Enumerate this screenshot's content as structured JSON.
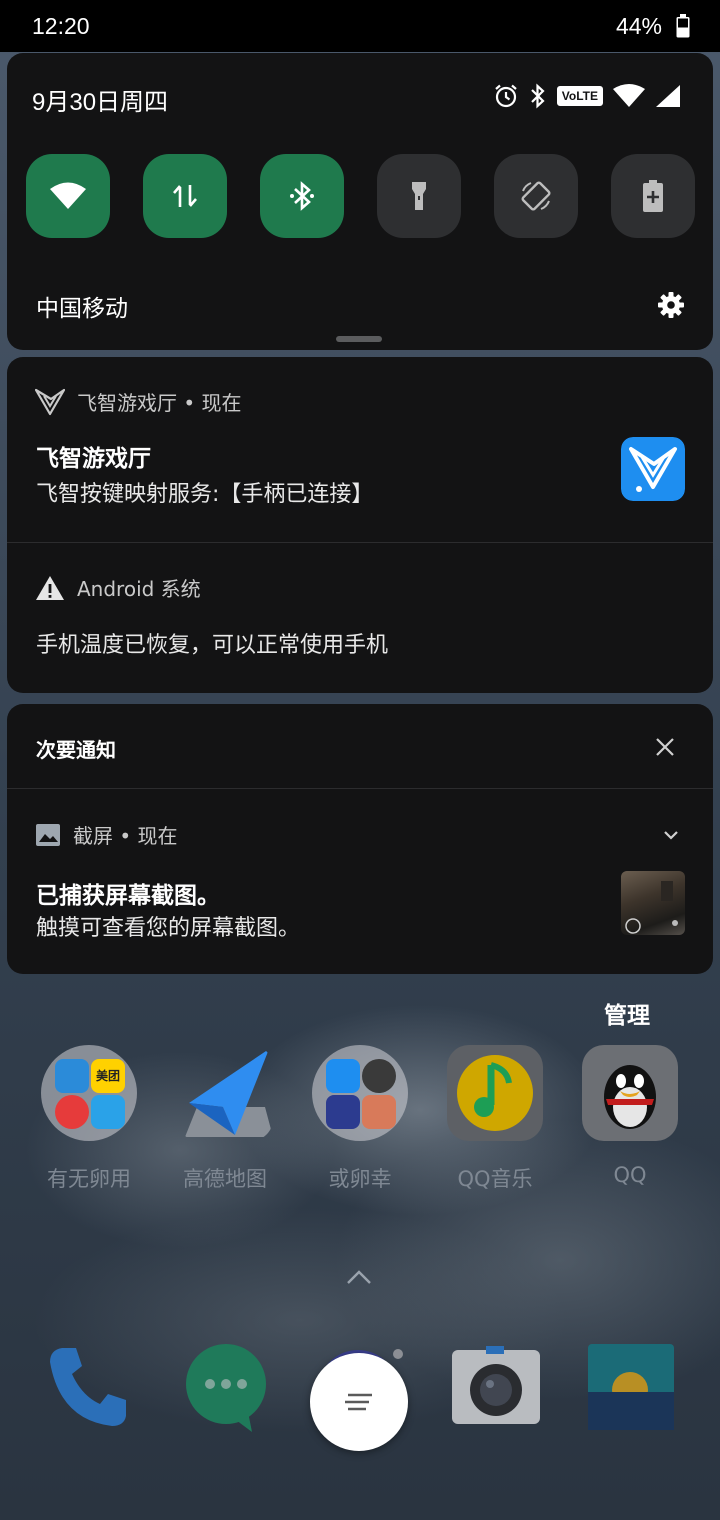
{
  "status_bar": {
    "time": "12:20",
    "battery": "44%"
  },
  "quick_settings": {
    "date": "9月30日周四",
    "volte": "VoLTE",
    "carrier": "中国移动",
    "tiles": [
      {
        "name": "wifi",
        "state": "on"
      },
      {
        "name": "mobile-data",
        "state": "on"
      },
      {
        "name": "bluetooth",
        "state": "on"
      },
      {
        "name": "flashlight",
        "state": "off"
      },
      {
        "name": "auto-rotate",
        "state": "off"
      },
      {
        "name": "battery-saver",
        "state": "off"
      }
    ],
    "accent_on": "#1f7a4d",
    "tile_off": "#2e2f31"
  },
  "notifications": {
    "feizhi": {
      "app_row": "飞智游戏厅 • 现在",
      "title": "飞智游戏厅",
      "text": "飞智按键映射服务:【手柄已连接】"
    },
    "android": {
      "app_row": "Android 系统",
      "text": "手机温度已恢复，可以正常使用手机"
    },
    "minor": {
      "header": "次要通知",
      "app_row": "截屏 • 现在",
      "title": "已捕获屏幕截图。",
      "text": "触摸可查看您的屏幕截图。"
    }
  },
  "home": {
    "manage": "管理",
    "apps": [
      {
        "label": "有无卵用",
        "icon": "folder-icon"
      },
      {
        "label": "高德地图",
        "icon": "amap-icon"
      },
      {
        "label": "或卵幸",
        "icon": "folder-icon"
      },
      {
        "label": "QQ音乐",
        "icon": "qqmusic-icon"
      },
      {
        "label": "QQ",
        "icon": "qq-icon"
      }
    ],
    "folder1_mini_meituan": "美团"
  },
  "dock": [
    "phone-icon",
    "messages-icon",
    "browser-icon",
    "camera-icon",
    "gallery-icon"
  ]
}
